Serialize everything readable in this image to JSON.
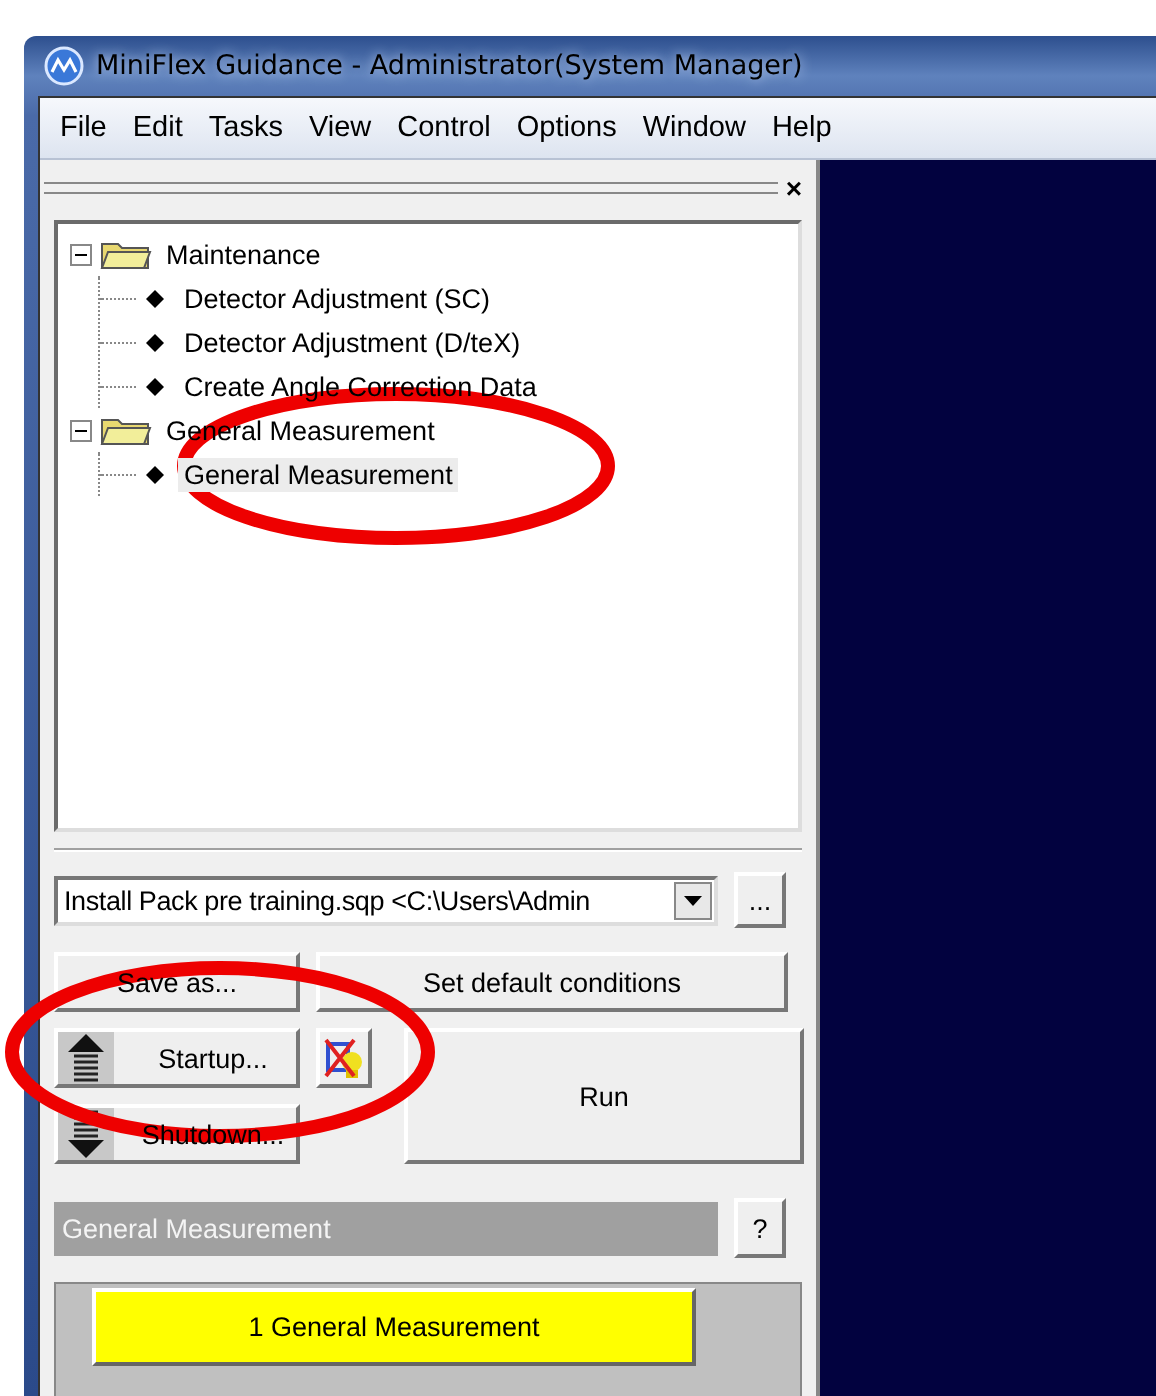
{
  "window": {
    "title": "MiniFlex Guidance - Administrator(System Manager)"
  },
  "menu": [
    "File",
    "Edit",
    "Tasks",
    "View",
    "Control",
    "Options",
    "Window",
    "Help"
  ],
  "pane": {
    "close": "×"
  },
  "tree": [
    {
      "label": "Maintenance",
      "expanded": true,
      "children": [
        {
          "label": "Detector Adjustment (SC)",
          "selected": false
        },
        {
          "label": "Detector Adjustment (D/teX)",
          "selected": false
        },
        {
          "label": "Create Angle Correction Data",
          "selected": false
        }
      ]
    },
    {
      "label": "General Measurement",
      "expanded": true,
      "children": [
        {
          "label": "General Measurement",
          "selected": true
        }
      ]
    }
  ],
  "file_select": {
    "value": "Install Pack pre training.sqp <C:\\Users\\Admin",
    "browse": "..."
  },
  "buttons": {
    "save_as": "Save as...",
    "set_default": "Set default conditions",
    "startup": "Startup...",
    "shutdown": "Shutdown...",
    "run": "Run"
  },
  "section": {
    "title": "General Measurement",
    "help": "?"
  },
  "steps": [
    {
      "label": "1 General Measurement",
      "selected": true
    }
  ]
}
